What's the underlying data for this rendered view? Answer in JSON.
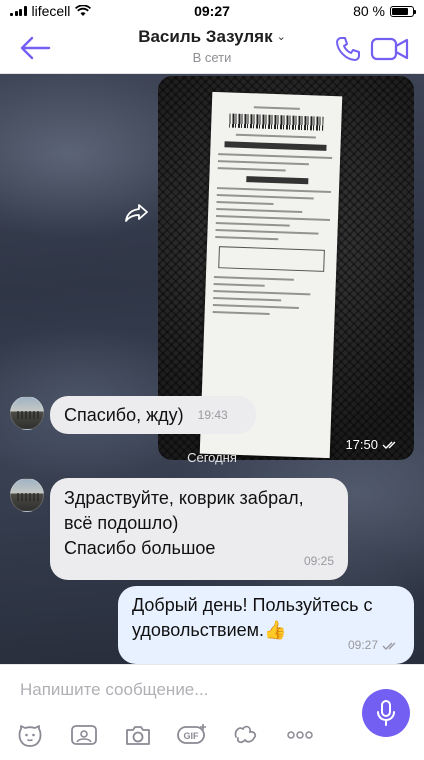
{
  "status_bar": {
    "carrier": "lifecell",
    "time": "09:27",
    "battery_percent": "80 %",
    "battery_level": 0.8
  },
  "header": {
    "contact_name": "Василь Зазуляк",
    "presence": "В сети"
  },
  "chat": {
    "image_message": {
      "time": "17:50"
    },
    "messages": [
      {
        "text": "Спасибо, жду)",
        "time": "19:43"
      },
      {
        "text_lines": [
          "Здраствуйте, коврик забрал,",
          "всё подошло)",
          "Спасибо большое"
        ],
        "time": "09:25"
      },
      {
        "text_lines": [
          "Добрый день! Пользуйтесь с",
          "удовольствием."
        ],
        "emoji": "👍",
        "time": "09:27"
      }
    ],
    "date_separator": "Сегодня"
  },
  "composer": {
    "placeholder": "Напишите сообщение...",
    "tools": [
      "sticker-icon",
      "doodle-icon",
      "camera-icon",
      "gif-icon",
      "wink-icon",
      "more-icon"
    ]
  },
  "colors": {
    "accent": "#7360f2",
    "outgoing_bubble": "#e8f1ff",
    "incoming_bubble": "#ececee"
  }
}
